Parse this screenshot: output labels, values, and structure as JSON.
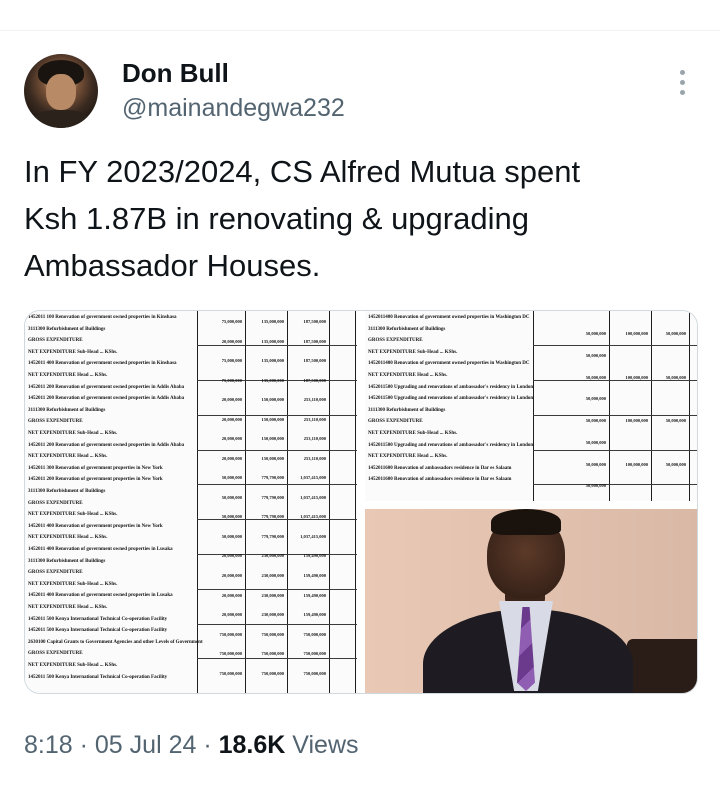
{
  "tweet": {
    "author_name": "Don Bull",
    "author_handle": "@mainandegwa232",
    "text_lines": [
      "In FY 2023/2024, CS Alfred Mutua spent",
      "Ksh 1.87B in renovating & upgrading",
      "Ambassador Houses."
    ],
    "time": "8:18",
    "date": "05 Jul 24",
    "separator": "·",
    "views_count": "18.6K",
    "views_label": "Views"
  },
  "icons": {
    "more": "more-vertical-icon",
    "avatar": "avatar"
  },
  "document_left": {
    "rows": [
      "1452011 100 Renovation of government owned properties in Kinshasa",
      "3111300 Refurbishment of Buildings",
      "GROSS EXPENDITURE",
      "NET EXPENDITURE Sub-Head ... KShs.",
      "1452011 400 Renovation of government owned properties in Kinshasa",
      "NET EXPENDITURE Head ... KShs.",
      "1452011 200 Renovation of government owned properties in Addis Ababa",
      "1452011 200 Renovation of government owned properties in Addis Ababa",
      "3111300 Refurbishment of Buildings",
      "GROSS EXPENDITURE",
      "NET EXPENDITURE Sub-Head ... KShs.",
      "1452011 200 Renovation of government owned properties in Addis Ababa",
      "NET EXPENDITURE Head ... KShs.",
      "1452011 300 Renovation of government properties in New York",
      "1452011 200 Renovation of government properties in New York",
      "3111300 Refurbishment of Buildings",
      "GROSS EXPENDITURE",
      "NET EXPENDITURE Sub-Head ... KShs.",
      "1452011 400 Renovation of government properties in New York",
      "NET EXPENDITURE Head ... KShs.",
      "1452011 400 Renovation of government owned properties in Lusaka",
      "3111300 Refurbishment of Buildings",
      "GROSS EXPENDITURE",
      "NET EXPENDITURE Sub-Head ... KShs.",
      "1452011 400 Renovation of government owned properties in Lusaka",
      "NET EXPENDITURE Head ... KShs.",
      "1452011 500 Kenya International Technical Co-operation Facility",
      "1452011 500 Kenya International Technical Co-operation Facility",
      "2630100 Capital Grants to Government Agencies and other Levels of Government",
      "GROSS EXPENDITURE",
      "NET EXPENDITURE Sub-Head ... KShs.",
      "1452011 500 Kenya International Technical Co-operation Facility"
    ],
    "values_a": [
      "75,000,000",
      "20,000,000",
      "75,000,000",
      "75,000,000",
      "20,000,000",
      "20,000,000",
      "20,000,000",
      "20,000,000",
      "50,000,000",
      "50,000,000",
      "50,000,000",
      "50,000,000",
      "20,000,000",
      "20,000,000",
      "20,000,000",
      "20,000,000",
      "750,000,000",
      "750,000,000",
      "750,000,000"
    ],
    "values_b": [
      "135,000,000",
      "135,000,000",
      "135,000,000",
      "135,000,000",
      "150,000,000",
      "150,000,000",
      "150,000,000",
      "150,000,000",
      "779,790,000",
      "779,790,000",
      "779,790,000",
      "779,790,000",
      "230,000,000",
      "230,000,000",
      "230,000,000",
      "230,000,000",
      "750,000,000",
      "750,000,000",
      "750,000,000"
    ],
    "values_c": [
      "187,500,000",
      "187,500,000",
      "187,500,000",
      "187,500,000",
      "253,110,000",
      "253,110,000",
      "253,110,000",
      "253,110,000",
      "1,037,415,000",
      "1,037,415,000",
      "1,037,415,000",
      "1,037,415,000",
      "159,490,000",
      "159,490,000",
      "159,490,000",
      "159,490,000",
      "750,000,000",
      "750,000,000",
      "750,000,000"
    ]
  },
  "document_right": {
    "rows": [
      "1452011400 Renovation of government owned properties in Washington DC",
      "3111300 Refurbishment of Buildings",
      "GROSS EXPENDITURE",
      "NET EXPENDITURE Sub-Head ... KShs.",
      "1452011400 Renovation of government owned properties in Washington DC",
      "NET EXPENDITURE Head ... KShs.",
      "1452011500 Upgrading and renovations of ambassador's residency in London",
      "1452011500 Upgrading and renovations of ambassador's residency in London",
      "3111300 Refurbishment of Buildings",
      "GROSS EXPENDITURE",
      "NET EXPENDITURE Sub-Head ... KShs.",
      "1452011500 Upgrading and renovations of ambassador's residency in London",
      "NET EXPENDITURE Head ... KShs.",
      "1452011600 Renovation of ambassadors residence in Dar es Salaam",
      "1452011600 Renovation of ambassadors residence in Dar es Salaam"
    ],
    "values_a": [
      "50,000,000",
      "50,000,000",
      "50,000,000",
      "50,000,000",
      "50,000,000",
      "50,000,000",
      "50,000,000",
      "50,000,000"
    ],
    "values_b": [
      "100,000,000",
      "100,000,000",
      "100,000,000",
      "100,000,000"
    ],
    "values_c": [
      "50,000,000",
      "50,000,000",
      "50,000,000",
      "50,000,000"
    ]
  },
  "colors": {
    "text_primary": "#0f1419",
    "text_secondary": "#536471",
    "border": "#cfd9de"
  }
}
